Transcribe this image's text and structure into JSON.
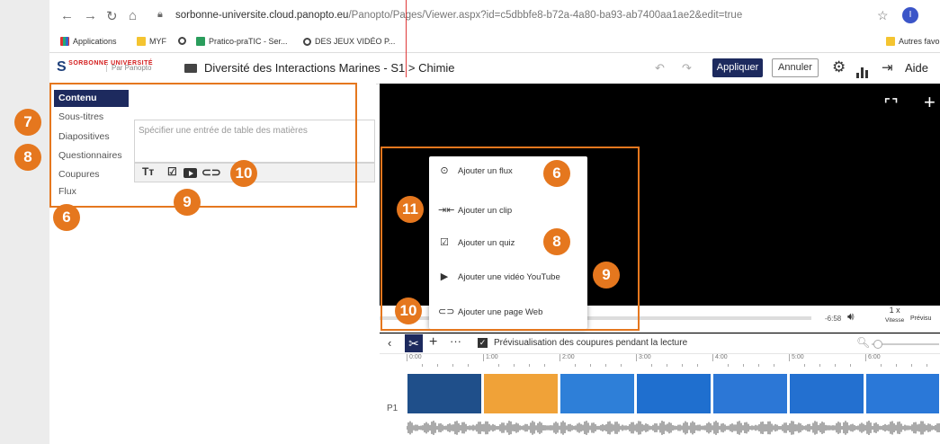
{
  "browser": {
    "url_host": "sorbonne-universite.cloud.panopto.eu",
    "url_path": "/Panopto/Pages/Viewer.aspx?id=c5dbbfe8-b72a-4a80-ba93-ab7400aa1ae2&edit=true",
    "bookmarks": [
      "Applications",
      "MYF",
      "Pratico-praTIC - Ser...",
      "DES JEUX VIDÉO P..."
    ],
    "other_bookmarks": "Autres favoris",
    "profile_initial": "I"
  },
  "app": {
    "logo_text": "SORBONNE UNIVERSITÉ",
    "by_panopto": "Par Panopto",
    "breadcrumb": "Diversité des Interactions Marines - S1  >  Chimie",
    "apply_label": "Appliquer",
    "cancel_label": "Annuler",
    "help_label": "Aide"
  },
  "left_panel": {
    "tabs": [
      "Contenu",
      "Sous-titres",
      "Diapositives",
      "Questionnaires",
      "Coupures",
      "Flux"
    ],
    "toc_placeholder": "Spécifier une entrée de table des matières"
  },
  "menu": {
    "items": [
      "Ajouter un flux",
      "Ajouter un clip",
      "Ajouter un quiz",
      "Ajouter une vidéo YouTube",
      "Ajouter une page Web"
    ]
  },
  "player": {
    "remaining_time": "-6:58",
    "speed": "1 x",
    "speed_label": "Vitesse",
    "preview_label": "Prévisu"
  },
  "editor": {
    "preview_cuts_label": "Prévisualisation des coupures pendant la lecture",
    "track_label": "P1",
    "ruler_ticks": [
      "0:00",
      "1:00",
      "2:00",
      "3:00",
      "4:00",
      "5:00",
      "6:00"
    ]
  },
  "annotations": [
    "7",
    "8",
    "6",
    "9",
    "10",
    "6",
    "11",
    "8",
    "9",
    "10"
  ],
  "colors": {
    "accent": "#e5771e",
    "brand": "#1d2a5e"
  },
  "icons": [
    "back-icon",
    "forward-icon",
    "reload-icon",
    "home-icon",
    "lock-icon",
    "star-icon",
    "folder-icon",
    "undo-icon",
    "redo-icon",
    "gear-icon",
    "stats-icon",
    "exit-icon",
    "fullscreen-icon",
    "plus-icon",
    "play-circle-icon",
    "clip-icon",
    "quiz-icon",
    "youtube-icon",
    "link-icon",
    "volume-icon",
    "scissors-icon",
    "more-icon",
    "zoom-icon",
    "text-size-icon"
  ]
}
